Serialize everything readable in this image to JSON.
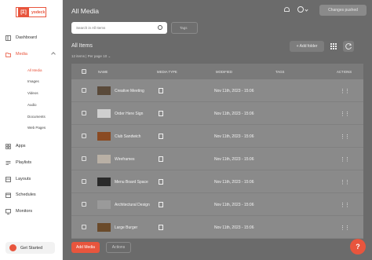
{
  "logo": {
    "mark": "[Ʃ]",
    "word": "yodeck"
  },
  "sidebar": {
    "items": [
      {
        "label": "Dashboard"
      },
      {
        "label": "Media"
      },
      {
        "label": "Apps"
      },
      {
        "label": "Playlists"
      },
      {
        "label": "Layouts"
      },
      {
        "label": "Schedules"
      },
      {
        "label": "Monitors"
      }
    ],
    "media_sub": [
      {
        "label": "All Media"
      },
      {
        "label": "Images"
      },
      {
        "label": "Videos"
      },
      {
        "label": "Audio"
      },
      {
        "label": "Documents"
      },
      {
        "label": "Web Pages"
      }
    ],
    "get_started": "Get Started"
  },
  "header": {
    "title": "All Media",
    "publish_label": "Changes pushed"
  },
  "filters": {
    "search_placeholder": "Search in All Items",
    "tags_label": "Tags"
  },
  "section": {
    "title": "All Items",
    "count": "12 items | Per page  10  ⌄",
    "add_folder": "+ Add folder"
  },
  "table": {
    "columns": {
      "name": "NAME",
      "media_type": "MEDIA TYPE",
      "modified": "MODIFIED",
      "tags": "TAGS",
      "actions": "ACTIONS"
    },
    "rows": [
      {
        "name": "Creative Meeting",
        "modified": "Nov 11th, 2023 - 15:06",
        "thumb": "#5a4a3a"
      },
      {
        "name": "Order Here Sign",
        "modified": "Nov 11th, 2023 - 15:06",
        "thumb": "#cfcfcf"
      },
      {
        "name": "Club Sandwich",
        "modified": "Nov 11th, 2023 - 15:06",
        "thumb": "#8a4a22"
      },
      {
        "name": "Wireframes",
        "modified": "Nov 11th, 2023 - 15:06",
        "thumb": "#b9b0a5"
      },
      {
        "name": "Menu Board Space",
        "modified": "Nov 11th, 2023 - 15:06",
        "thumb": "#2a2a2a"
      },
      {
        "name": "Architectural Design",
        "modified": "Nov 11th, 2023 - 15:06",
        "thumb": "#9a9a9a"
      },
      {
        "name": "Large Burger",
        "modified": "Nov 11th, 2023 - 15:06",
        "thumb": "#6a4a2a"
      }
    ]
  },
  "footer": {
    "add_media": "Add Media",
    "actions": "Actions",
    "help": "?"
  },
  "colors": {
    "accent": "#e8553d",
    "overlay": "#6b6b6b"
  }
}
